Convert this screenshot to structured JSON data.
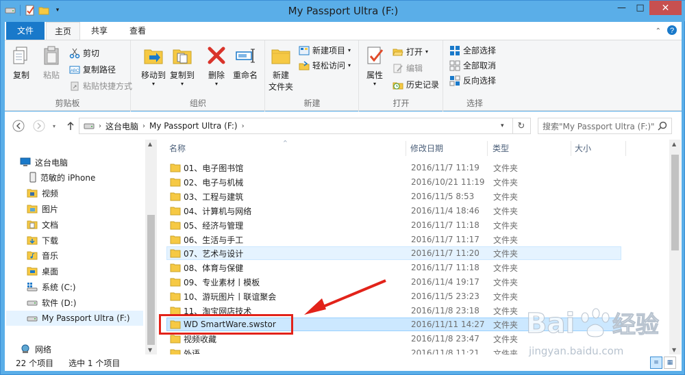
{
  "window": {
    "title": "My Passport Ultra (F:)",
    "min_glyph": "—",
    "max_glyph": "□",
    "close_glyph": "✕"
  },
  "ribbon_tabs": [
    {
      "label": "文件"
    },
    {
      "label": "主页"
    },
    {
      "label": "共享"
    },
    {
      "label": "查看"
    }
  ],
  "ribbon": {
    "clipboard": {
      "copy": "复制",
      "paste": "粘贴",
      "cut": "剪切",
      "copy_path": "复制路径",
      "paste_shortcut": "粘贴快捷方式",
      "label": "剪贴板"
    },
    "organize": {
      "move_to": "移动到",
      "copy_to": "复制到",
      "delete": "删除",
      "rename": "重命名",
      "label": "组织"
    },
    "new": {
      "new_folder_line1": "新建",
      "new_folder_line2": "文件夹",
      "new_item": "新建项目",
      "easy_access": "轻松访问",
      "label": "新建"
    },
    "open": {
      "properties": "属性",
      "open": "打开",
      "edit": "编辑",
      "history": "历史记录",
      "label": "打开"
    },
    "select": {
      "select_all": "全部选择",
      "select_none": "全部取消",
      "invert": "反向选择",
      "label": "选择"
    }
  },
  "address": {
    "crumbs": [
      "这台电脑",
      "My Passport Ultra (F:)"
    ],
    "search_placeholder": "搜索\"My Passport Ultra (F:)\""
  },
  "nav_pane": {
    "items": [
      {
        "label": "这台电脑",
        "icon": "computer-icon"
      },
      {
        "label": "范敏的 iPhone",
        "icon": "phone-icon"
      },
      {
        "label": "视频",
        "icon": "video-folder-icon"
      },
      {
        "label": "图片",
        "icon": "pictures-folder-icon"
      },
      {
        "label": "文档",
        "icon": "documents-folder-icon"
      },
      {
        "label": "下载",
        "icon": "downloads-folder-icon"
      },
      {
        "label": "音乐",
        "icon": "music-folder-icon"
      },
      {
        "label": "桌面",
        "icon": "desktop-folder-icon"
      },
      {
        "label": "系统 (C:)",
        "icon": "system-drive-icon"
      },
      {
        "label": "软件 (D:)",
        "icon": "drive-icon"
      },
      {
        "label": "My Passport Ultra (F:)",
        "icon": "drive-icon"
      },
      {
        "label": "网络",
        "icon": "network-icon"
      }
    ]
  },
  "columns": {
    "name": "名称",
    "modified": "修改日期",
    "type": "类型",
    "size": "大小"
  },
  "files": [
    {
      "name": "01、电子图书馆",
      "date": "2016/11/7 11:19",
      "type": "文件夹"
    },
    {
      "name": "02、电子与机械",
      "date": "2016/10/21 11:19",
      "type": "文件夹"
    },
    {
      "name": "03、工程与建筑",
      "date": "2016/11/5 8:53",
      "type": "文件夹"
    },
    {
      "name": "04、计算机与网络",
      "date": "2016/11/4 18:46",
      "type": "文件夹"
    },
    {
      "name": "05、经济与管理",
      "date": "2016/11/7 11:18",
      "type": "文件夹"
    },
    {
      "name": "06、生活与手工",
      "date": "2016/11/7 11:17",
      "type": "文件夹"
    },
    {
      "name": "07、艺术与设计",
      "date": "2016/11/7 11:20",
      "type": "文件夹"
    },
    {
      "name": "08、体育与保健",
      "date": "2016/11/7 11:18",
      "type": "文件夹"
    },
    {
      "name": "09、专业素材丨模板",
      "date": "2016/11/4 19:17",
      "type": "文件夹"
    },
    {
      "name": "10、游玩图片丨联谊聚会",
      "date": "2016/11/5 23:23",
      "type": "文件夹"
    },
    {
      "name": "11、淘宝网店技术",
      "date": "2016/11/8 23:18",
      "type": "文件夹"
    },
    {
      "name": "WD SmartWare.swstor",
      "date": "2016/11/11 14:27",
      "type": "文件夹"
    },
    {
      "name": "视频收藏",
      "date": "2016/11/8 23:47",
      "type": "文件夹"
    },
    {
      "name": "外语",
      "date": "2016/11/8 11:21",
      "type": "文件夹"
    }
  ],
  "status": {
    "count": "22 个项目",
    "selected": "选中 1 个项目"
  },
  "watermark": {
    "brand": "Bai",
    "brand2": "经验",
    "url": "jingyan.baidu.com"
  },
  "colors": {
    "titlebar": "#5aaee8",
    "file_tab": "#1979ca",
    "close": "#c75050",
    "selection": "#cce8ff",
    "annotation": "#e2231a"
  }
}
